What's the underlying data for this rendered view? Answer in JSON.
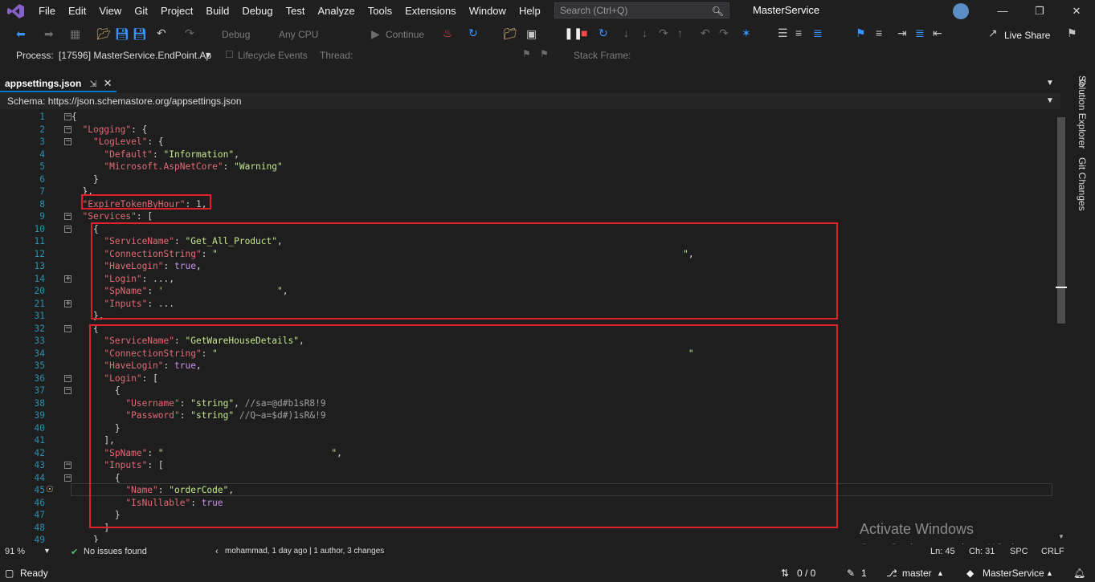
{
  "menu": {
    "items": [
      "File",
      "Edit",
      "View",
      "Git",
      "Project",
      "Build",
      "Debug",
      "Test",
      "Analyze",
      "Tools",
      "Extensions",
      "Window",
      "Help"
    ],
    "search_placeholder": "Search (Ctrl+Q)",
    "solution_name": "MasterService"
  },
  "toolbar": {
    "config": "Debug",
    "platform": "Any CPU",
    "continue_label": "Continue",
    "live_share": "Live Share"
  },
  "toolbar2": {
    "process_label": "Process:",
    "process_value": "[17596] MasterService.EndPoint.Ap",
    "lifecycle": "Lifecycle Events",
    "thread_label": "Thread:",
    "stack_frame_label": "Stack Frame:"
  },
  "tab": {
    "title": "appsettings.json"
  },
  "schema": {
    "text": "Schema:  https://json.schemastore.org/appsettings.json"
  },
  "code": {
    "line_numbers": [
      "1",
      "2",
      "3",
      "4",
      "5",
      "6",
      "7",
      "8",
      "9",
      "10",
      "11",
      "12",
      "13",
      "14",
      "20",
      "21",
      "31",
      "32",
      "33",
      "34",
      "35",
      "36",
      "37",
      "38",
      "39",
      "40",
      "41",
      "42",
      "43",
      "44",
      "45",
      "46",
      "47",
      "48",
      "49"
    ],
    "lines": [
      "{",
      "  \"Logging\": {",
      "    \"LogLevel\": {",
      "      \"Default\": \"Information\",",
      "      \"Microsoft.AspNetCore\": \"Warning\"",
      "    }",
      "  },",
      "  \"ExpireTokenByHour\": 1,",
      "  \"Services\": [",
      "    {",
      "      \"ServiceName\": \"Get_All_Product\",",
      "      \"ConnectionString\": \"                                                                                      \",",
      "      \"HaveLogin\": true,",
      "      \"Login\": ...,",
      "      \"SpName\": '                     \",",
      "      \"Inputs\": ...",
      "    },",
      "    {",
      "      \"ServiceName\": \"GetWareHouseDetails\",",
      "      \"ConnectionString\": \"                                                                                       \"",
      "      \"HaveLogin\": true,",
      "      \"Login\": [",
      "        {",
      "          \"Username\": \"string\", //sa=@d#b1sR8!9",
      "          \"Password\": \"string\" //Q~a=$d#)1sR&!9",
      "        }",
      "      ],",
      "      \"SpName\": \"                               \",",
      "      \"Inputs\": [",
      "        {",
      "          \"Name\": \"orderCode\",",
      "          \"IsNullable\": true",
      "        }",
      "      ]",
      "    }"
    ]
  },
  "watermark": {
    "title": "Activate Windows",
    "subtitle": "Go to Settings to activate Windows."
  },
  "editor_status": {
    "zoom": "91 %",
    "issues": "No issues found",
    "git_blame": "mohammad, 1 day ago | 1 author, 3 changes",
    "ln": "Ln: 45",
    "ch": "Ch: 31",
    "spc": "SPC",
    "crlf": "CRLF"
  },
  "status": {
    "ready": "Ready",
    "sync": "0 / 0",
    "commits": "1",
    "branch": "master",
    "repo": "MasterService"
  },
  "side_panels": [
    "Solution Explorer",
    "Git Changes"
  ],
  "colors": {
    "accent": "#0078d4",
    "highlight_box": "#e0202a",
    "key": "#e06c75",
    "string": "#c3e88d",
    "keyword": "#c792ea"
  }
}
